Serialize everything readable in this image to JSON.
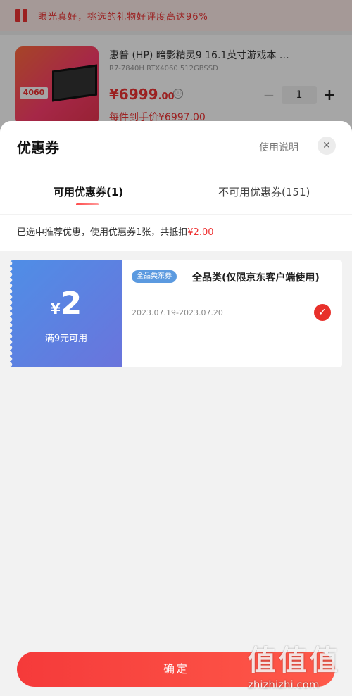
{
  "background": {
    "banner_text": "眼光真好，挑选的礼物好评度高达96%",
    "product": {
      "image_tag": "4060",
      "title": "惠普 (HP) 暗影精灵9 16.1英寸游戏本 …",
      "subtitle": "R7-7840H RTX4060 512GBSSD",
      "price_main": "¥6999",
      "price_decimal": ".00",
      "info_icon": "ⓘ",
      "qty": "1",
      "minus": "−",
      "plus": "+",
      "deal_text": "每件到手价¥6997.00"
    }
  },
  "sheet": {
    "title": "优惠券",
    "usage_link": "使用说明",
    "close_icon": "✕",
    "tabs": [
      {
        "label": "可用优惠券(1)",
        "active": true
      },
      {
        "label": "不可用优惠券(151)",
        "active": false
      }
    ],
    "summary_prefix": "已选中推荐优惠，使用优惠券1张，共抵扣",
    "summary_amount": "¥2.00",
    "coupons": [
      {
        "yen": "¥",
        "value": "2",
        "condition": "满9元可用",
        "badge": "全品类东券",
        "name": "全品类(仅限京东客户端使用)",
        "dates": "2023.07.19-2023.07.20",
        "selected": true,
        "check_icon": "✓"
      }
    ],
    "confirm_label": "确定"
  },
  "watermark": {
    "logo": "值值值",
    "url": "zhizhizhi.com"
  },
  "colors": {
    "accent": "#e8302a",
    "coupon_gradient_start": "#4f8ee6",
    "coupon_gradient_end": "#6a74dc"
  }
}
